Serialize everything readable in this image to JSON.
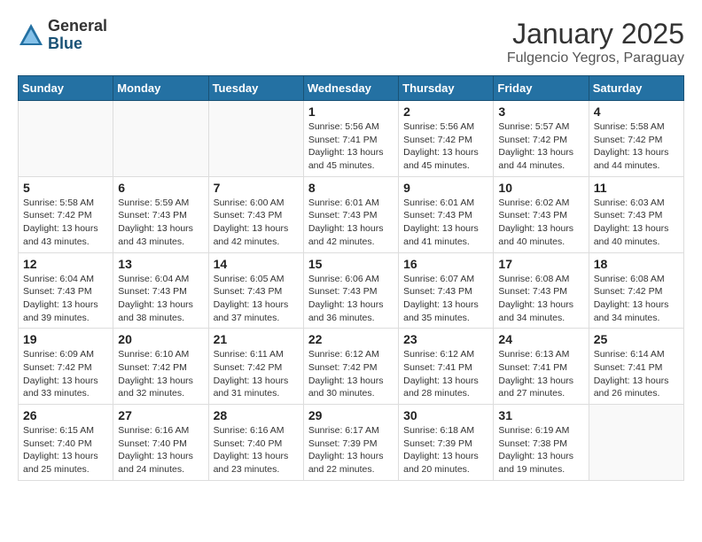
{
  "header": {
    "logo_general": "General",
    "logo_blue": "Blue",
    "month_title": "January 2025",
    "subtitle": "Fulgencio Yegros, Paraguay"
  },
  "days_of_week": [
    "Sunday",
    "Monday",
    "Tuesday",
    "Wednesday",
    "Thursday",
    "Friday",
    "Saturday"
  ],
  "weeks": [
    [
      {
        "day": "",
        "info": ""
      },
      {
        "day": "",
        "info": ""
      },
      {
        "day": "",
        "info": ""
      },
      {
        "day": "1",
        "info": "Sunrise: 5:56 AM\nSunset: 7:41 PM\nDaylight: 13 hours\nand 45 minutes."
      },
      {
        "day": "2",
        "info": "Sunrise: 5:56 AM\nSunset: 7:42 PM\nDaylight: 13 hours\nand 45 minutes."
      },
      {
        "day": "3",
        "info": "Sunrise: 5:57 AM\nSunset: 7:42 PM\nDaylight: 13 hours\nand 44 minutes."
      },
      {
        "day": "4",
        "info": "Sunrise: 5:58 AM\nSunset: 7:42 PM\nDaylight: 13 hours\nand 44 minutes."
      }
    ],
    [
      {
        "day": "5",
        "info": "Sunrise: 5:58 AM\nSunset: 7:42 PM\nDaylight: 13 hours\nand 43 minutes."
      },
      {
        "day": "6",
        "info": "Sunrise: 5:59 AM\nSunset: 7:43 PM\nDaylight: 13 hours\nand 43 minutes."
      },
      {
        "day": "7",
        "info": "Sunrise: 6:00 AM\nSunset: 7:43 PM\nDaylight: 13 hours\nand 42 minutes."
      },
      {
        "day": "8",
        "info": "Sunrise: 6:01 AM\nSunset: 7:43 PM\nDaylight: 13 hours\nand 42 minutes."
      },
      {
        "day": "9",
        "info": "Sunrise: 6:01 AM\nSunset: 7:43 PM\nDaylight: 13 hours\nand 41 minutes."
      },
      {
        "day": "10",
        "info": "Sunrise: 6:02 AM\nSunset: 7:43 PM\nDaylight: 13 hours\nand 40 minutes."
      },
      {
        "day": "11",
        "info": "Sunrise: 6:03 AM\nSunset: 7:43 PM\nDaylight: 13 hours\nand 40 minutes."
      }
    ],
    [
      {
        "day": "12",
        "info": "Sunrise: 6:04 AM\nSunset: 7:43 PM\nDaylight: 13 hours\nand 39 minutes."
      },
      {
        "day": "13",
        "info": "Sunrise: 6:04 AM\nSunset: 7:43 PM\nDaylight: 13 hours\nand 38 minutes."
      },
      {
        "day": "14",
        "info": "Sunrise: 6:05 AM\nSunset: 7:43 PM\nDaylight: 13 hours\nand 37 minutes."
      },
      {
        "day": "15",
        "info": "Sunrise: 6:06 AM\nSunset: 7:43 PM\nDaylight: 13 hours\nand 36 minutes."
      },
      {
        "day": "16",
        "info": "Sunrise: 6:07 AM\nSunset: 7:43 PM\nDaylight: 13 hours\nand 35 minutes."
      },
      {
        "day": "17",
        "info": "Sunrise: 6:08 AM\nSunset: 7:43 PM\nDaylight: 13 hours\nand 34 minutes."
      },
      {
        "day": "18",
        "info": "Sunrise: 6:08 AM\nSunset: 7:42 PM\nDaylight: 13 hours\nand 34 minutes."
      }
    ],
    [
      {
        "day": "19",
        "info": "Sunrise: 6:09 AM\nSunset: 7:42 PM\nDaylight: 13 hours\nand 33 minutes."
      },
      {
        "day": "20",
        "info": "Sunrise: 6:10 AM\nSunset: 7:42 PM\nDaylight: 13 hours\nand 32 minutes."
      },
      {
        "day": "21",
        "info": "Sunrise: 6:11 AM\nSunset: 7:42 PM\nDaylight: 13 hours\nand 31 minutes."
      },
      {
        "day": "22",
        "info": "Sunrise: 6:12 AM\nSunset: 7:42 PM\nDaylight: 13 hours\nand 30 minutes."
      },
      {
        "day": "23",
        "info": "Sunrise: 6:12 AM\nSunset: 7:41 PM\nDaylight: 13 hours\nand 28 minutes."
      },
      {
        "day": "24",
        "info": "Sunrise: 6:13 AM\nSunset: 7:41 PM\nDaylight: 13 hours\nand 27 minutes."
      },
      {
        "day": "25",
        "info": "Sunrise: 6:14 AM\nSunset: 7:41 PM\nDaylight: 13 hours\nand 26 minutes."
      }
    ],
    [
      {
        "day": "26",
        "info": "Sunrise: 6:15 AM\nSunset: 7:40 PM\nDaylight: 13 hours\nand 25 minutes."
      },
      {
        "day": "27",
        "info": "Sunrise: 6:16 AM\nSunset: 7:40 PM\nDaylight: 13 hours\nand 24 minutes."
      },
      {
        "day": "28",
        "info": "Sunrise: 6:16 AM\nSunset: 7:40 PM\nDaylight: 13 hours\nand 23 minutes."
      },
      {
        "day": "29",
        "info": "Sunrise: 6:17 AM\nSunset: 7:39 PM\nDaylight: 13 hours\nand 22 minutes."
      },
      {
        "day": "30",
        "info": "Sunrise: 6:18 AM\nSunset: 7:39 PM\nDaylight: 13 hours\nand 20 minutes."
      },
      {
        "day": "31",
        "info": "Sunrise: 6:19 AM\nSunset: 7:38 PM\nDaylight: 13 hours\nand 19 minutes."
      },
      {
        "day": "",
        "info": ""
      }
    ]
  ]
}
